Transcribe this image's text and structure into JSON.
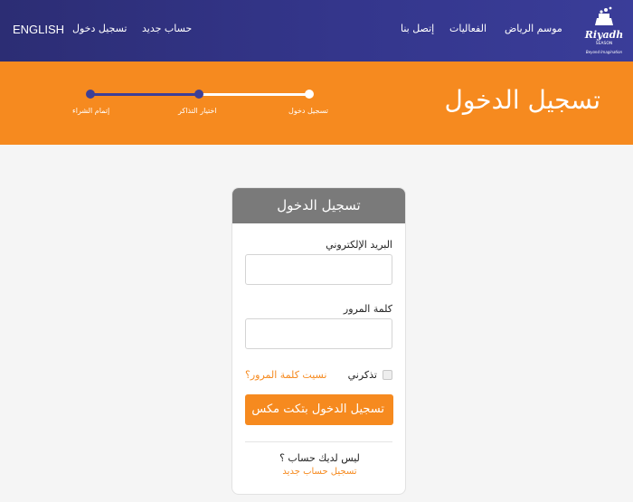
{
  "nav": {
    "language": "ENGLISH",
    "login": "تسجيل دخول",
    "register": "حساب جديد",
    "contact": "إتصل بنا",
    "events": "الفعاليات",
    "season": "موسم الرياض",
    "logo_text": "Riyadh",
    "logo_sub": "SEASON",
    "logo_tag": "Beyond Imagination"
  },
  "banner": {
    "title": "تسجيل الدخول",
    "steps": [
      {
        "label": "إتمام الشراء",
        "state": "pending"
      },
      {
        "label": "اختيار التذاكر",
        "state": "pending"
      },
      {
        "label": "تسجيل دخول",
        "state": "current"
      }
    ]
  },
  "form": {
    "heading": "تسجيل الدخول",
    "email_label": "البريد الإلكتروني",
    "email_value": "",
    "password_label": "كلمة المرور",
    "password_value": "",
    "remember_label": "تذكرني",
    "forgot_link": "نسيت كلمة المرور؟",
    "submit_label": "تسجيل الدخول بتكت مكس",
    "no_account": "ليس لديك حساب ؟",
    "register_link": "تسجيل حساب جديد"
  },
  "colors": {
    "nav_bg": "#34368c",
    "accent": "#f68a1f",
    "card_head": "#7a7a7a"
  }
}
